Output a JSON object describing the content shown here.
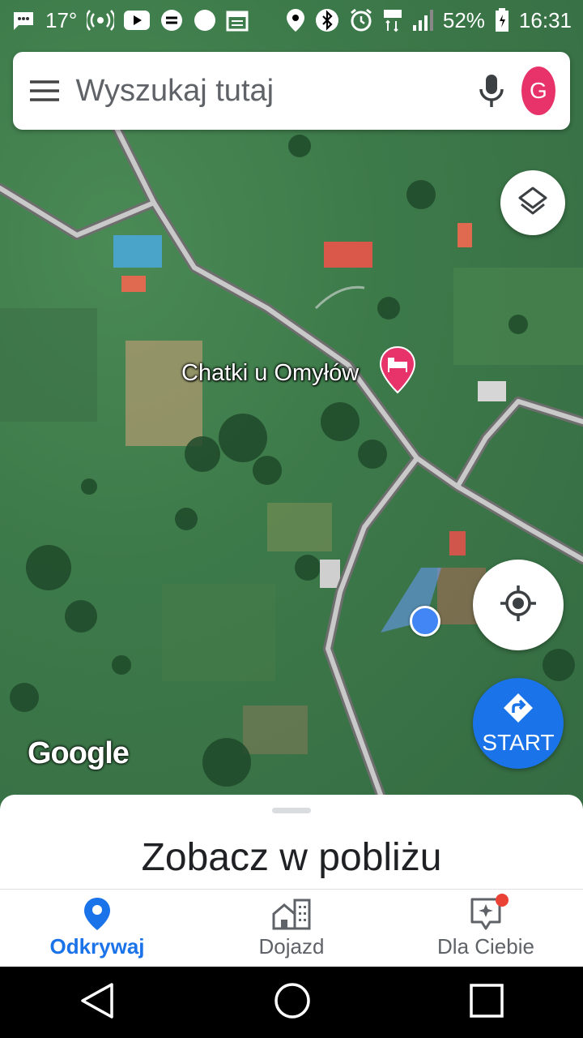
{
  "status_bar": {
    "temperature": "17°",
    "battery": "52%",
    "time": "16:31",
    "icons": [
      "message-icon",
      "wireless-icon",
      "youtube-icon",
      "app-icon",
      "circle-icon",
      "calendar-icon",
      "location-icon",
      "bluetooth-icon",
      "alarm-icon",
      "lte-icon",
      "signal-icon",
      "battery-icon"
    ]
  },
  "search": {
    "placeholder": "Wyszukaj tutaj",
    "avatar_letter": "G"
  },
  "map": {
    "place_name": "Chatki u Omyłów",
    "attribution": "Google",
    "start_label": "START"
  },
  "sheet": {
    "title": "Zobacz w pobliżu"
  },
  "bottom_nav": {
    "items": [
      {
        "label": "Odkrywaj",
        "icon": "explore-pin-icon",
        "active": true
      },
      {
        "label": "Dojazd",
        "icon": "commute-icon",
        "active": false
      },
      {
        "label": "Dla Ciebie",
        "icon": "for-you-icon",
        "active": false
      }
    ]
  },
  "colors": {
    "accent": "#1a73e8",
    "avatar": "#e8336a",
    "place_pin": "#e8336a",
    "badge": "#ea4335"
  }
}
